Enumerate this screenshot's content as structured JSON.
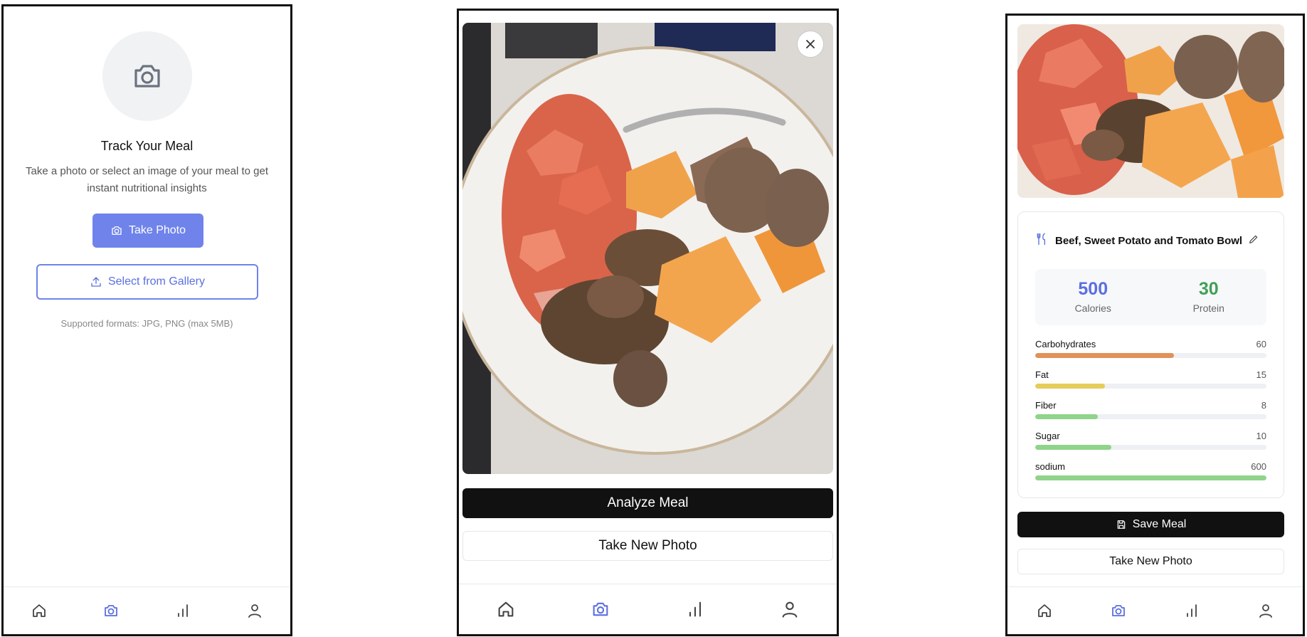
{
  "screen1": {
    "title": "Track Your Meal",
    "subtitle": "Take a photo or select an image of your meal to get instant nutritional insights",
    "take_photo_label": "Take Photo",
    "gallery_label": "Select from Gallery",
    "formats_note": "Supported formats: JPG, PNG (max 5MB)"
  },
  "screen2": {
    "analyze_label": "Analyze Meal",
    "new_photo_label": "Take New Photo"
  },
  "screen3": {
    "meal_name": "Beef, Sweet Potato and Tomato Bowl",
    "calories_value": "500",
    "calories_label": "Calories",
    "protein_value": "30",
    "protein_label": "Protein",
    "nutrients": [
      {
        "name": "Carbohydrates",
        "value": "60",
        "fill": 0.6,
        "color": "#e0925a"
      },
      {
        "name": "Fat",
        "value": "15",
        "fill": 0.3,
        "color": "#e6cc5a"
      },
      {
        "name": "Fiber",
        "value": "8",
        "fill": 0.27,
        "color": "#8fd48a"
      },
      {
        "name": "Sugar",
        "value": "10",
        "fill": 0.33,
        "color": "#8fd48a"
      },
      {
        "name": "sodium",
        "value": "600",
        "fill": 1.0,
        "color": "#8fd48a"
      }
    ],
    "save_label": "Save Meal",
    "new_photo_label": "Take New Photo"
  },
  "nav": {
    "icons": [
      "home-icon",
      "camera-icon",
      "bar-chart-icon",
      "user-icon"
    ],
    "active": "camera-icon"
  },
  "colors": {
    "accent": "#6f83ea",
    "calories": "#5b6fe0",
    "protein": "#3fa055",
    "dark_button": "#111111"
  }
}
